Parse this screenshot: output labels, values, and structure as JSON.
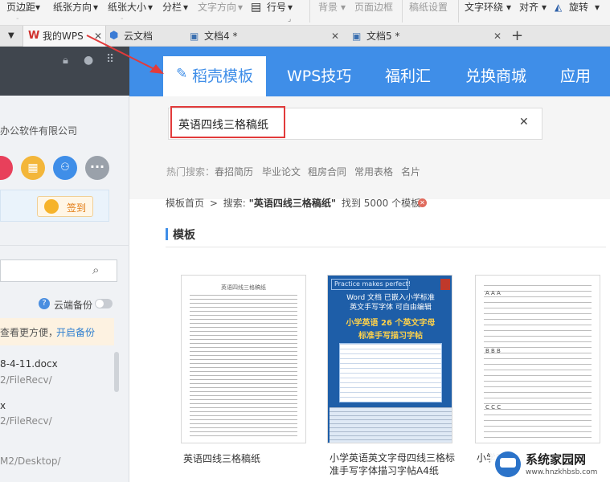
{
  "ribbon": {
    "margins": "页边距",
    "orientation": "纸张方向",
    "size": "纸张大小",
    "columns": "分栏",
    "text_direction": "文字方向",
    "line_numbers": "行号",
    "background": "背景",
    "page_border": "页面边框",
    "paper_settings": "稿纸设置",
    "text_wrap": "文字环绕",
    "align": "对齐",
    "rotate": "旋转"
  },
  "tabs": [
    {
      "label": "我的WPS"
    },
    {
      "label": "云文档"
    },
    {
      "label": "文档4 *"
    },
    {
      "label": "文档5 *"
    }
  ],
  "sidebar": {
    "company": "办公软件有限公司",
    "checkin": "签到",
    "cloud_backup": "云端备份",
    "backup_notice": "查看更方便，",
    "backup_link": "开启备份",
    "files": [
      {
        "name": "8-4-11.docx",
        "path": "2/FileRecv/"
      },
      {
        "name": "x",
        "path": "2/FileRecv/"
      },
      {
        "name": "",
        "path": "M2/Desktop/"
      }
    ]
  },
  "nav": {
    "items": [
      "稻壳模板",
      "WPS技巧",
      "福利汇",
      "兑换商城",
      "应用"
    ]
  },
  "search": {
    "query": "英语四线三格稿纸",
    "hot_label": "热门搜索：",
    "hot_items": [
      "春招简历",
      "毕业论文",
      "租房合同",
      "常用表格",
      "名片"
    ]
  },
  "breadcrumb": {
    "home": "模板首页",
    "sep": ">",
    "search_label": "搜索:",
    "query": "\"英语四线三格稿纸\"",
    "found": "找到 5000 个模板"
  },
  "section_title": "模板",
  "cards": [
    {
      "title": "英语四线三格稿纸",
      "thumb_title": "英语四线三格稿纸"
    },
    {
      "title": "小学英语英文字母四线三格标准手写字体描习字帖A4纸",
      "thumb_lines": [
        "Practice makes perfect!",
        "Word 文档 已嵌入小学标准",
        "英文手写字体 可自由编辑",
        "小学英语 26 个英文字母",
        "标准手写描习字帖"
      ]
    },
    {
      "title": "小学四",
      "thumb_lines": [
        "A A A",
        "B B B",
        "C C C"
      ]
    }
  ],
  "watermark": {
    "name": "系统家园网",
    "url": "www.hnzkhbsb.com"
  },
  "colors": {
    "nav_blue": "#3f8ee8",
    "highlight_red": "#e23b3b",
    "link_blue": "#2f7fd0"
  }
}
